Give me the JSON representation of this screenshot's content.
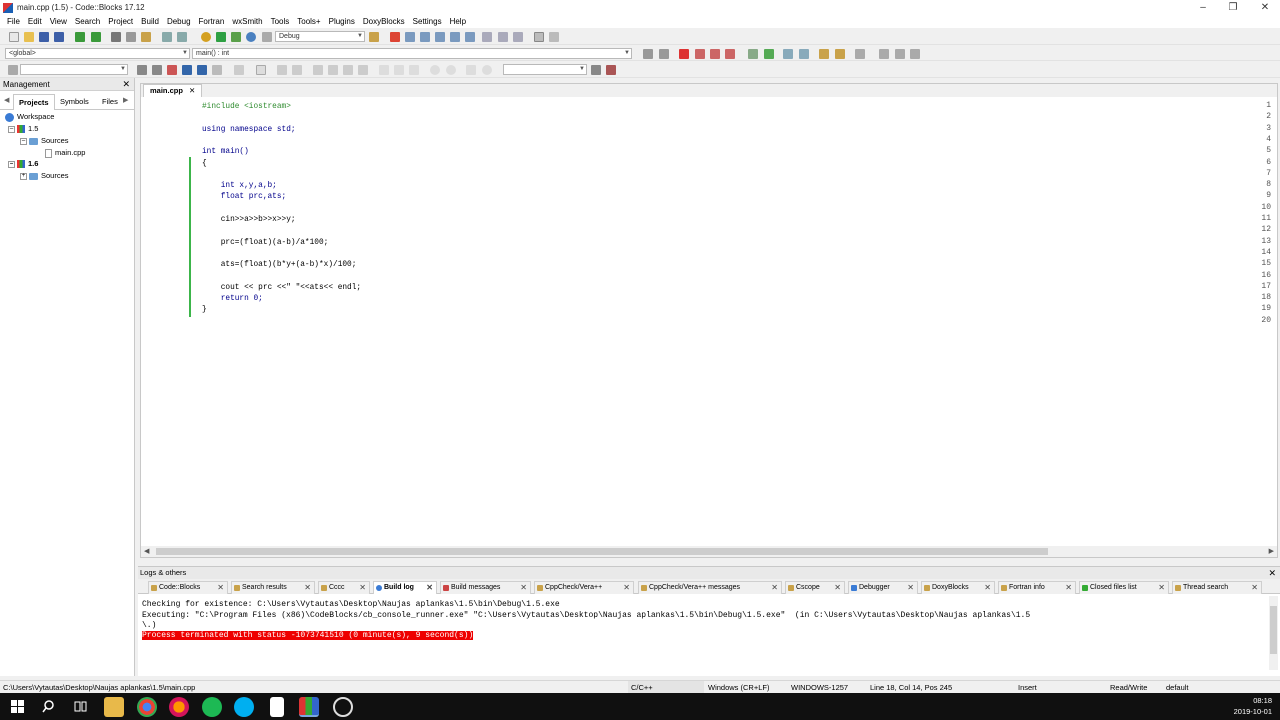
{
  "window": {
    "title": "main.cpp (1.5) - Code::Blocks 17.12"
  },
  "menu": [
    "File",
    "Edit",
    "View",
    "Search",
    "Project",
    "Build",
    "Debug",
    "Fortran",
    "wxSmith",
    "Tools",
    "Tools+",
    "Plugins",
    "DoxyBlocks",
    "Settings",
    "Help"
  ],
  "toolbar": {
    "build_target": "Debug",
    "scope": "<global>",
    "function": "main() : int",
    "search_value": ""
  },
  "management": {
    "title": "Management",
    "tabs": [
      "Projects",
      "Symbols",
      "Files"
    ],
    "tree": {
      "workspace": "Workspace",
      "project1": "1.5",
      "sources1": "Sources",
      "file1": "main.cpp",
      "project2": "1.6",
      "sources2": "Sources"
    }
  },
  "editor": {
    "tab": "main.cpp",
    "lines": [
      {
        "n": "1",
        "t": "#include <iostream>"
      },
      {
        "n": "2",
        "t": ""
      },
      {
        "n": "3",
        "t": "using namespace std;"
      },
      {
        "n": "4",
        "t": ""
      },
      {
        "n": "5",
        "t": "int main()"
      },
      {
        "n": "6",
        "t": "{"
      },
      {
        "n": "7",
        "t": ""
      },
      {
        "n": "8",
        "t": "    int x,y,a,b;"
      },
      {
        "n": "9",
        "t": "    float prc,ats;"
      },
      {
        "n": "10",
        "t": ""
      },
      {
        "n": "11",
        "t": "    cin>>a>>b>>x>>y;"
      },
      {
        "n": "12",
        "t": ""
      },
      {
        "n": "13",
        "t": "    prc=(float)(a-b)/a*100;"
      },
      {
        "n": "14",
        "t": ""
      },
      {
        "n": "15",
        "t": "    ats=(float)(b*y+(a-b)*x)/100;"
      },
      {
        "n": "16",
        "t": ""
      },
      {
        "n": "17",
        "t": "    cout << prc <<\" \"<<ats<< endl;"
      },
      {
        "n": "18",
        "t": "    return 0;"
      },
      {
        "n": "19",
        "t": "}"
      },
      {
        "n": "20",
        "t": ""
      }
    ]
  },
  "logs": {
    "title": "Logs & others",
    "tabs": [
      "Code::Blocks",
      "Search results",
      "Cccc",
      "Build log",
      "Build messages",
      "CppCheck/Vera++",
      "CppCheck/Vera++ messages",
      "Cscope",
      "Debugger",
      "DoxyBlocks",
      "Fortran info",
      "Closed files list",
      "Thread search"
    ],
    "active_tab": "Build log",
    "lines": [
      "Checking for existence: C:\\Users\\Vytautas\\Desktop\\Naujas aplankas\\1.5\\bin\\Debug\\1.5.exe",
      "Executing: \"C:\\Program Files (x86)\\CodeBlocks/cb_console_runner.exe\" \"C:\\Users\\Vytautas\\Desktop\\Naujas aplankas\\1.5\\bin\\Debug\\1.5.exe\"  (in C:\\Users\\Vytautas\\Desktop\\Naujas aplankas\\1.5",
      "\\.)"
    ],
    "error_line": "Process terminated with status -1073741510 (0 minute(s), 9 second(s))"
  },
  "status": {
    "path": "C:\\Users\\Vytautas\\Desktop\\Naujas aplankas\\1.5\\main.cpp",
    "lang": "C/C++",
    "eol": "Windows (CR+LF)",
    "encoding": "WINDOWS-1257",
    "position": "Line 18, Col 14, Pos 245",
    "mode": "Insert",
    "rw": "Read/Write",
    "theme": "default"
  },
  "taskbar": {
    "time": "08:18",
    "date": "2019-10-01"
  }
}
